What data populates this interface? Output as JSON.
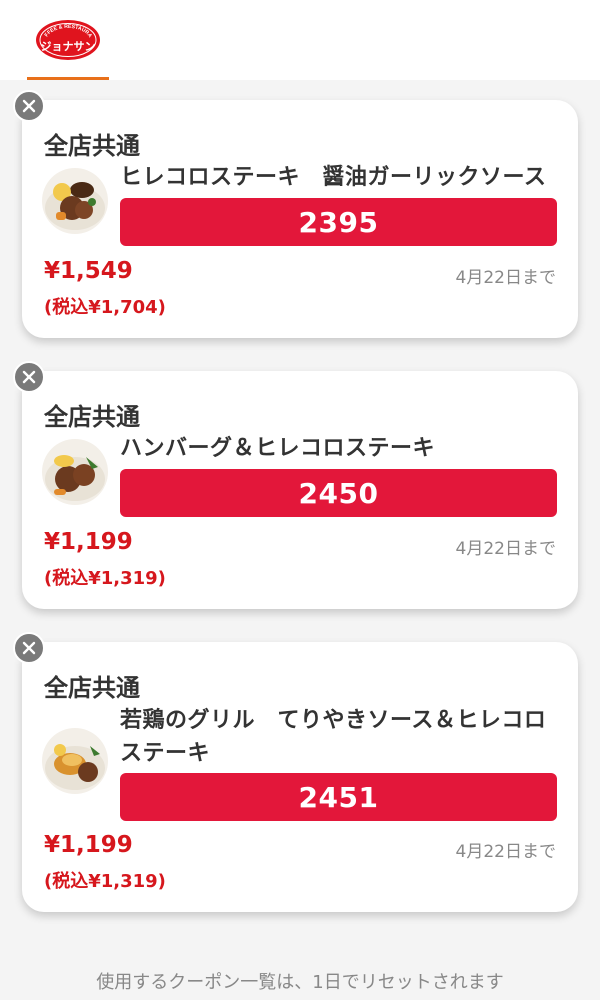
{
  "header": {
    "brand_small": "COFFEE & RESTAURANT",
    "brand_name": "ジョナサン",
    "accent_color": "#e8701a"
  },
  "coupons": [
    {
      "area": "全店共通",
      "title": "ヒレコロステーキ　醤油ガーリックソース",
      "code": "2395",
      "price": "¥1,549",
      "price_tax": "(税込¥1,704)",
      "expiry": "4月22日まで"
    },
    {
      "area": "全店共通",
      "title": "ハンバーグ＆ヒレコロステーキ",
      "code": "2450",
      "price": "¥1,199",
      "price_tax": "(税込¥1,319)",
      "expiry": "4月22日まで"
    },
    {
      "area": "全店共通",
      "title": "若鶏のグリル　てりやきソース＆ヒレコロステーキ",
      "code": "2451",
      "price": "¥1,199",
      "price_tax": "(税込¥1,319)",
      "expiry": "4月22日まで"
    }
  ],
  "footer": {
    "note": "使用するクーポン一覧は、1日でリセットされます"
  },
  "colors": {
    "code_bar": "#e3173a",
    "price": "#d6171d"
  }
}
